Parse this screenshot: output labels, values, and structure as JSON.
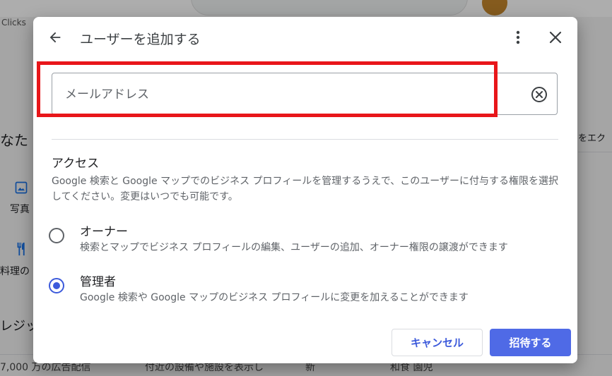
{
  "background": {
    "clicks_text": "Clicks",
    "left_heading": "なた",
    "photo_label": "写真",
    "menu_label": "料理の",
    "credit_label": "レジッ",
    "bottom_text_1": "7,000 万の広告配信",
    "bottom_text_2": "付近の設備や施設を表示し",
    "bottom_text_3": "新",
    "bottom_text_4": "和食 園児",
    "right_text": "をエク"
  },
  "dialog": {
    "title": "ユーザーを追加する",
    "email": {
      "placeholder": "メールアドレス",
      "value": ""
    },
    "access": {
      "heading": "アクセス",
      "description": "Google 検索と Google マップでのビジネス プロフィールを管理するうえで、このユーザーに付与する権限を選択してください。変更はいつでも可能です。"
    },
    "roles": [
      {
        "label": "オーナー",
        "description": "検索とマップでビジネス プロフィールの編集、ユーザーの追加、オーナー権限の譲渡ができます",
        "selected": false
      },
      {
        "label": "管理者",
        "description": "Google 検索や Google マップのビジネス プロフィールに変更を加えることができます",
        "selected": true
      }
    ],
    "buttons": {
      "cancel": "キャンセル",
      "invite": "招待する"
    }
  },
  "colors": {
    "accent": "#3c5adb",
    "primary_button": "#4f6ae6",
    "highlight": "#e8161a"
  }
}
